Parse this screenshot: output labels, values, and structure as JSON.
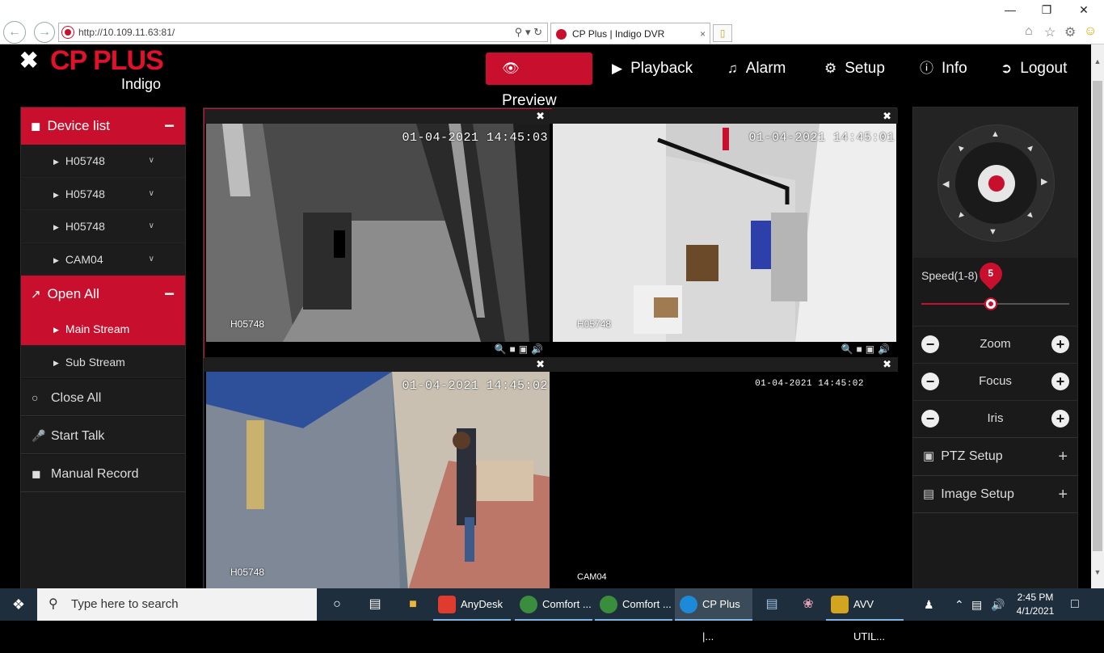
{
  "browser": {
    "address": "http://10.109.11.63:81/",
    "tab_title": "CP Plus | Indigo DVR",
    "tab_close": "×",
    "back_icon": "back-arrow-icon",
    "forward_icon": "forward-arrow-icon"
  },
  "header": {
    "logo_brand": "CP PLUS",
    "logo_sub": "Indigo",
    "nav": [
      {
        "label": "Preview",
        "icon": "eye-icon",
        "active": true
      },
      {
        "label": "Playback",
        "icon": "play-circle-icon"
      },
      {
        "label": "Alarm",
        "icon": "bell-icon"
      },
      {
        "label": "Setup",
        "icon": "gear-icon"
      },
      {
        "label": "Info",
        "icon": "info-icon"
      },
      {
        "label": "Logout",
        "icon": "logout-icon"
      }
    ]
  },
  "sidebar": {
    "device_list": {
      "title": "Device list",
      "toggle": "−"
    },
    "devices": [
      {
        "label": "H05748"
      },
      {
        "label": "H05748"
      },
      {
        "label": "H05748"
      },
      {
        "label": "CAM04"
      }
    ],
    "open_all": {
      "title": "Open All",
      "toggle": "−"
    },
    "streams": [
      {
        "label": "Main Stream",
        "selected": true
      },
      {
        "label": "Sub Stream",
        "selected": false
      }
    ],
    "close_all": "Close All",
    "start_talk": "Start Talk",
    "manual_record": "Manual Record"
  },
  "cameras": [
    {
      "timestamp": "01-04-2021 14:45:03",
      "name": "H05748",
      "scene": "dark interior corridor"
    },
    {
      "timestamp": "01-04-2021 14:45:01",
      "name": "H05748",
      "scene": "server room"
    },
    {
      "timestamp": "01-04-2021 14:45:02",
      "name": "H05748",
      "scene": "shop front"
    },
    {
      "timestamp": "01-04-2021 14:45:02",
      "name": "CAM04",
      "scene": "no signal"
    }
  ],
  "ptz": {
    "speed_label": "Speed(1-8)",
    "speed_value": "5",
    "speed_min": 1,
    "speed_max": 8,
    "speed_current": 5,
    "controls": [
      {
        "label": "Zoom"
      },
      {
        "label": "Focus"
      },
      {
        "label": "Iris"
      }
    ],
    "ptz_setup": "PTZ Setup",
    "image_setup": "Image Setup"
  },
  "taskbar": {
    "search_placeholder": "Type here to search",
    "apps": [
      {
        "label": "AnyDesk",
        "color": "#e03b2f"
      },
      {
        "label": "Comfort ...",
        "color": "#3b8d3e"
      },
      {
        "label": "Comfort ...",
        "color": "#3b8d3e"
      },
      {
        "label": "CP Plus |...",
        "color": "#1c8ad8"
      },
      {
        "label": "AVV UTIL...",
        "color": "#d2a520"
      }
    ],
    "time": "2:45 PM",
    "date": "4/1/2021"
  },
  "colors": {
    "accent": "#c8102e",
    "background": "#000000",
    "panel": "#1c1c1c"
  }
}
